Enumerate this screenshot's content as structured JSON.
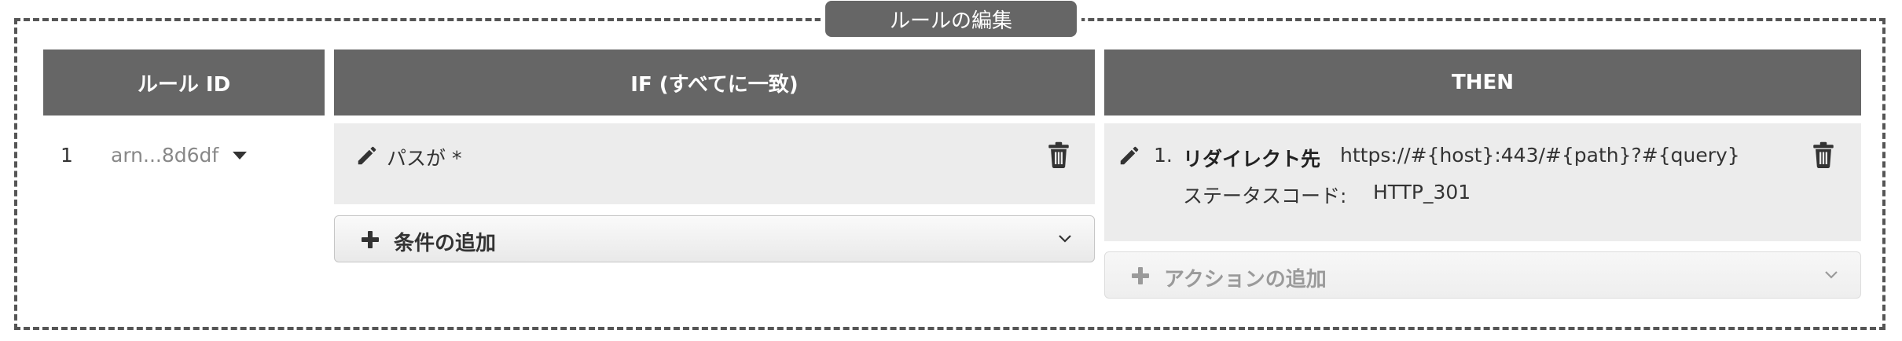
{
  "panel": {
    "title": "ルールの編集"
  },
  "columns": {
    "rule_id": "ルール ID",
    "if": "IF (すべてに一致)",
    "then": "THEN"
  },
  "rule": {
    "number": "1",
    "arn": "arn...8d6df"
  },
  "condition": {
    "text": "パスが *",
    "add_label": "条件の追加"
  },
  "action": {
    "number": "1.",
    "label": "リダイレクト先",
    "url": "https://#{host}:443/#{path}?#{query}",
    "status_label": "ステータスコード:",
    "status_value": "HTTP_301",
    "add_label": "アクションの追加"
  },
  "icons": {
    "edit": "pencil-icon",
    "delete": "trash-icon",
    "add": "plus-icon",
    "expand": "chevron-down-icon",
    "dropdown": "caret-down-icon"
  },
  "colors": {
    "header_bg": "#666666",
    "box_bg": "#ececec",
    "text": "#333333",
    "muted": "#888888"
  }
}
